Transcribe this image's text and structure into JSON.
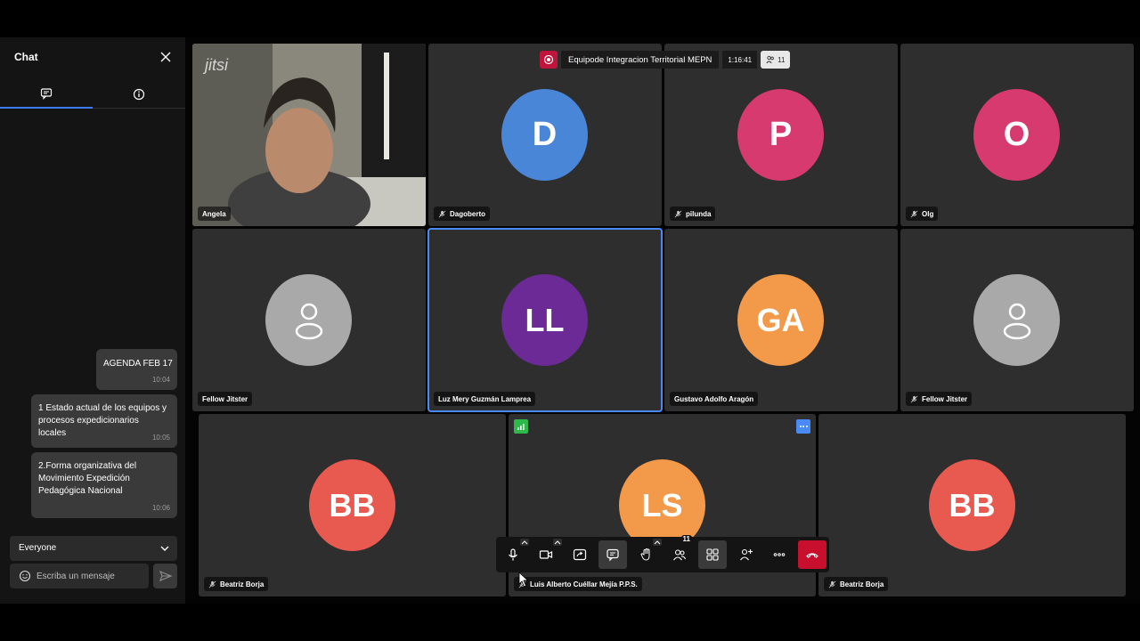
{
  "chat": {
    "title": "Chat",
    "messages": [
      {
        "text": "AGENDA FEB 17",
        "time": "10:04"
      },
      {
        "text": "1 Estado actual de los equipos y procesos expedicionarios locales",
        "time": "10:05"
      },
      {
        "text": "2.Forma organizativa del Movimiento Expedición Pedagógica Nacional",
        "time": "10:06"
      }
    ],
    "recipient": "Everyone",
    "input_placeholder": "Escriba un mensaje"
  },
  "meeting": {
    "title": "Equipode Integracion Territorial MEPN",
    "timer": "1:16:41",
    "participant_count": "11",
    "logo": "jitsi"
  },
  "participants": [
    {
      "name": "Angela",
      "initials": "",
      "color": "",
      "video": true
    },
    {
      "name": "Dagoberto",
      "initials": "D",
      "color": "#4a86d8",
      "muted": true
    },
    {
      "name": "pilunda",
      "initials": "P",
      "color": "#d63a6e",
      "muted": true
    },
    {
      "name": "Olg",
      "initials": "O",
      "color": "#d63a6e",
      "muted": true
    },
    {
      "name": "Fellow Jitster",
      "initials": "",
      "color": "#a9a9a9",
      "muted": false
    },
    {
      "name": "Luz Mery Guzmán Lamprea",
      "initials": "LL",
      "color": "#6b2a96",
      "muted": false
    },
    {
      "name": "Gustavo Adolfo Aragón",
      "initials": "GA",
      "color": "#f2994a",
      "muted": false
    },
    {
      "name": "Fellow Jitster",
      "initials": "",
      "color": "#a9a9a9",
      "muted": true
    },
    {
      "name": "Beatriz Borja",
      "initials": "BB",
      "color": "#e85a50",
      "muted": true
    },
    {
      "name": "Luis Alberto Cuéllar Mejía P.P.S.",
      "initials": "LS",
      "color": "#f2994a",
      "muted": true
    },
    {
      "name": "Beatriz Borja",
      "initials": "BB",
      "color": "#e85a50",
      "muted": true
    }
  ],
  "toolbar": {
    "participants_badge": "11"
  },
  "colors": {
    "accent": "#4a8af7",
    "hangup": "#c8102e",
    "record": "#c0143c"
  }
}
